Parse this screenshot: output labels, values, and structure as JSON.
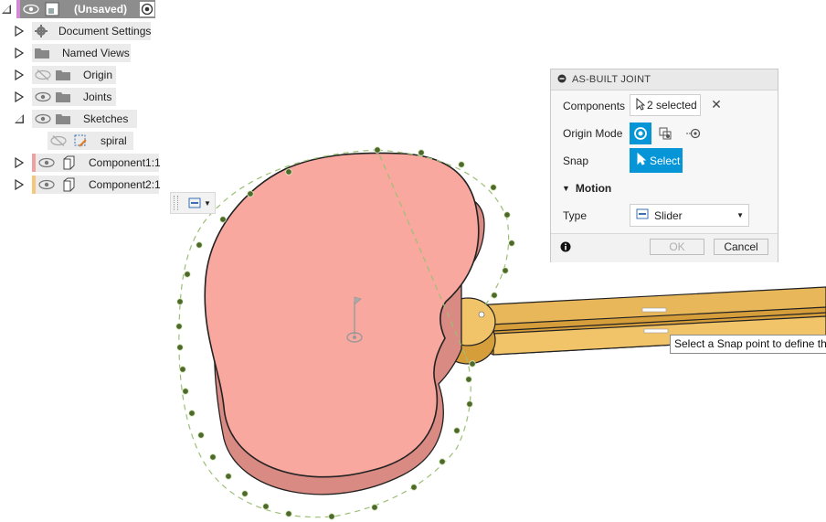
{
  "browser": {
    "root": {
      "label": "(Unsaved)",
      "icons": [
        "expand-collapse-icon",
        "eye-icon",
        "document-icon",
        "radio-target-icon"
      ]
    },
    "items": [
      {
        "label": "Document Settings",
        "icon": "gear-icon"
      },
      {
        "label": "Named Views",
        "icon": "folder-icon"
      },
      {
        "label": "Origin",
        "icon": "folder-icon",
        "eye": "hidden"
      },
      {
        "label": "Joints",
        "icon": "folder-icon"
      },
      {
        "label": "Sketches",
        "icon": "folder-icon",
        "expanded": true
      },
      {
        "label": "spiral",
        "icon": "sketch-icon",
        "eye": "hidden"
      },
      {
        "label": "Component1:1",
        "icon": "component-icon",
        "color": "#f0a0a0"
      },
      {
        "label": "Component2:1",
        "icon": "component-icon",
        "color": "#f5c77a"
      }
    ]
  },
  "viewport": {
    "tooltip": "Select a Snap point to define the",
    "mini_toolbar_icon": "slider-joint-icon"
  },
  "dialog": {
    "title": "AS-BUILT JOINT",
    "components_label": "Components",
    "components_value": "2 selected",
    "origin_mode_label": "Origin Mode",
    "snap_label": "Snap",
    "snap_button": "Select",
    "motion_label": "Motion",
    "type_label": "Type",
    "type_value": "Slider",
    "ok_label": "OK",
    "cancel_label": "Cancel"
  },
  "colors": {
    "accent": "#0696d7",
    "component1": "#f8a89e",
    "component2": "#f2c46a"
  }
}
